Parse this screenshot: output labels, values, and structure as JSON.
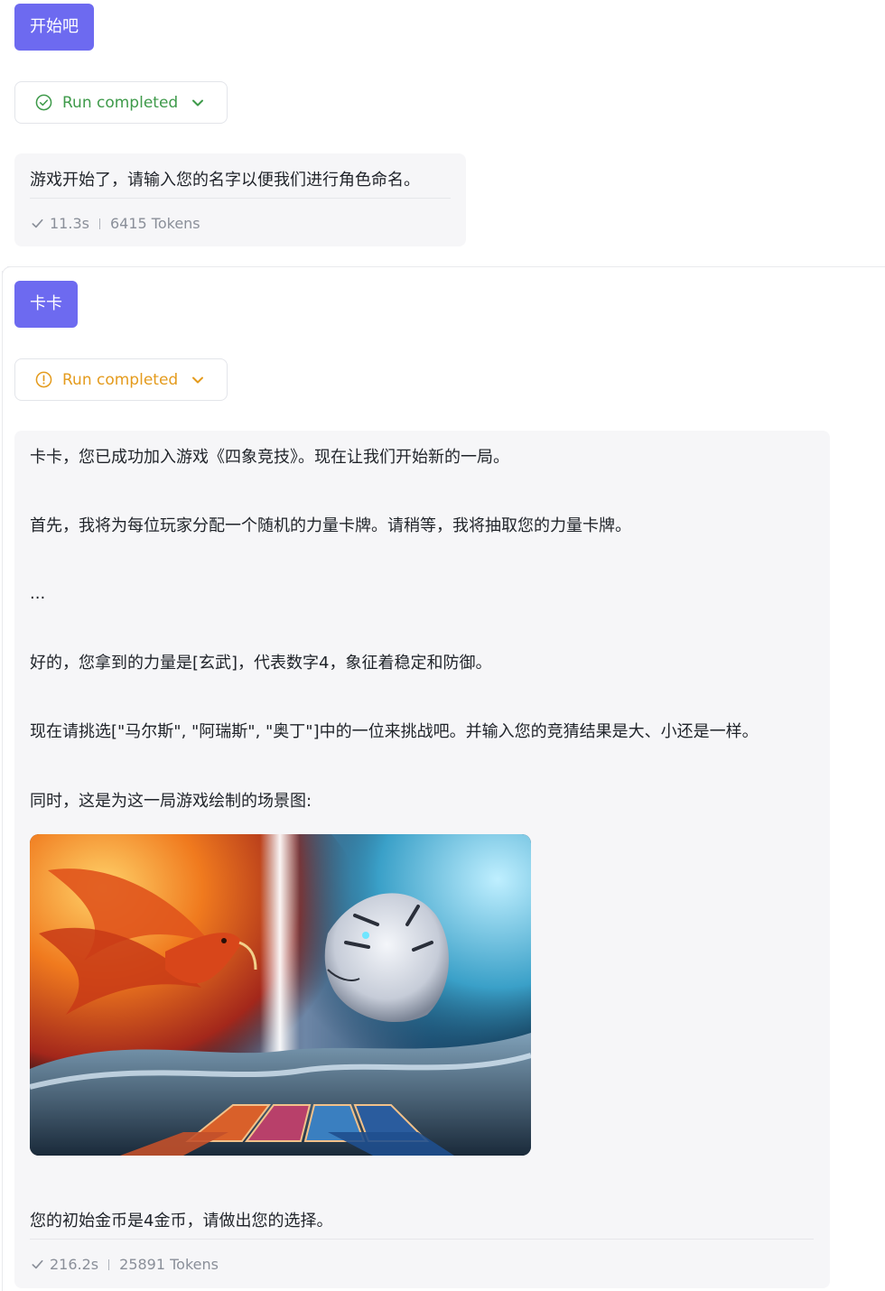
{
  "conversation": {
    "turn1": {
      "user_message": "开始吧",
      "run_status": "Run completed",
      "reply": "游戏开始了，请输入您的名字以便我们进行角色命名。",
      "duration": "11.3s",
      "tokens": "6415 Tokens"
    },
    "turn2": {
      "user_message": "卡卡",
      "run_status": "Run completed",
      "reply_lines": [
        "卡卡，您已成功加入游戏《四象竞技》。现在让我们开始新的一局。",
        "首先，我将为每位玩家分配一个随机的力量卡牌。请稍等，我将抽取您的力量卡牌。",
        "...",
        "好的，您拿到的力量是[玄武]，代表数字4，象征着稳定和防御。",
        "现在请挑选[\"马尔斯\", \"阿瑞斯\", \"奥丁\"]中的一位来挑战吧。并输入您的竞猜结果是大、小还是一样。",
        "同时，这是为这一局游戏绘制的场景图:"
      ],
      "reply_final": "您的初始金币是4金币，请做出您的选择。",
      "duration": "216.2s",
      "tokens": "25891 Tokens"
    }
  },
  "colors": {
    "user_bubble": "#6d6af0",
    "status_success": "#3e9a4a",
    "status_warning": "#e49b1d",
    "reply_bg": "#f6f6f8"
  },
  "icons": {
    "status_success": "check-circle-icon",
    "status_warning": "alert-circle-icon",
    "expand": "chevron-down-icon",
    "meta": "check-icon"
  }
}
